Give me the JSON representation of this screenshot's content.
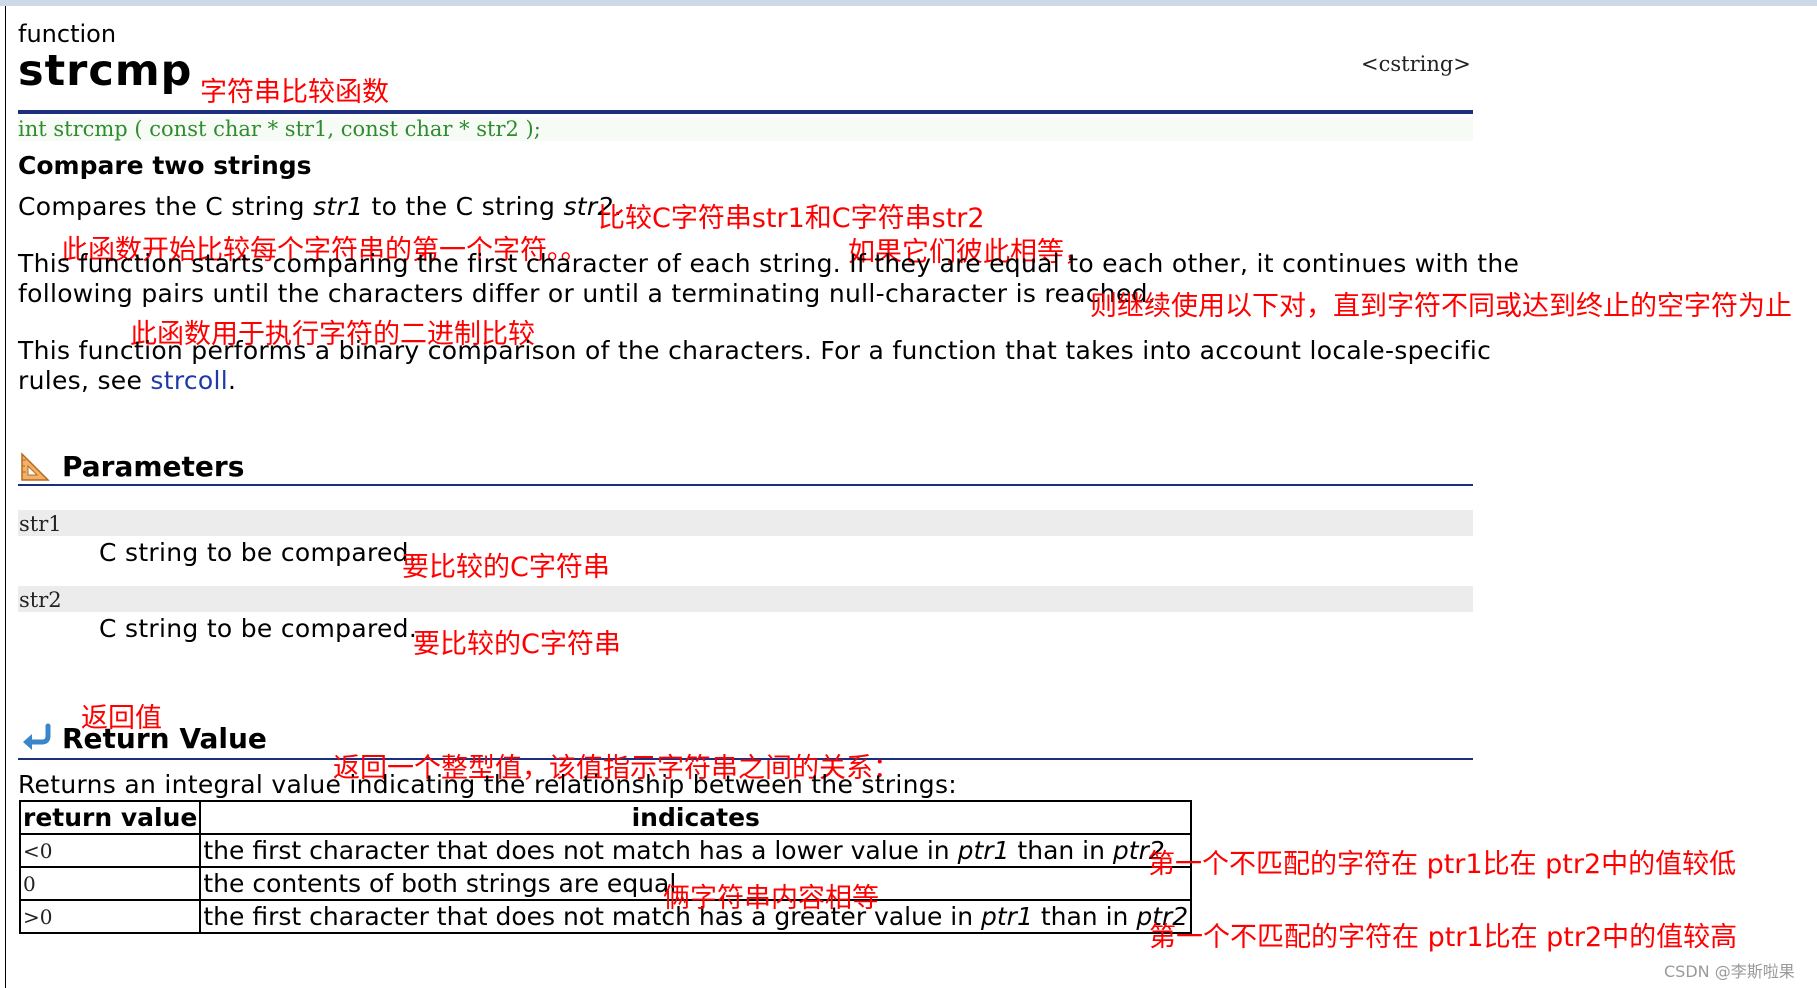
{
  "header": {
    "kind": "function",
    "name": "strcmp",
    "name_cn": "字符串比较函数",
    "library": "<cstring>"
  },
  "prototype": "int strcmp ( const char * str1, const char * str2 );",
  "summary": "Compare two strings",
  "desc1": {
    "p1": "Compares the C string ",
    "v1": "str1",
    "p2": " to the C string ",
    "v2": "str2",
    "p3": ".",
    "cn": "比较C字符串str1和C字符串str2"
  },
  "desc2": {
    "line1": "This function starts comparing the first character of each string. If they are equal to each other, it continues with the",
    "line2": "following pairs until the characters differ or until a terminating null-character is reached.",
    "cn_a": "此函数开始比较每个字符串的第一个字符。。",
    "cn_b": "如果它们彼此相等，",
    "cn_c": "则继续使用以下对，直到字符不同或达到终止的空字符为止"
  },
  "desc3": {
    "line1": "This function performs a binary comparison of the characters. For a function that takes into account locale-specific",
    "line2_pre": "rules, see ",
    "link": "strcoll",
    "line2_post": ".",
    "cn": "此函数用于执行字符的二进制比较"
  },
  "parameters": {
    "title": "Parameters",
    "items": [
      {
        "name": "str1",
        "desc": "C string to be compared.",
        "cn": "要比较的C字符串"
      },
      {
        "name": "str2",
        "desc": "C string to be compared.",
        "cn": "要比较的C字符串"
      }
    ]
  },
  "return_value": {
    "title": "Return Value",
    "title_cn": "返回值",
    "intro": "Returns an integral value indicating the relationship between the strings:",
    "intro_cn": "返回一个整型值，该值指示字符串之间的关系：",
    "headers": [
      "return value",
      "indicates"
    ],
    "rows": [
      {
        "val": "<0",
        "pre": "the first character that does not match has a lower value in ",
        "a": "ptr1",
        "mid": " than in ",
        "b": "ptr2",
        "cn": "第一个不匹配的字符在 ptr1比在 ptr2中的值较低"
      },
      {
        "val": "0",
        "text": "the contents of both strings are equal",
        "cn": "俩字符串内容相等"
      },
      {
        "val": ">0",
        "pre": "the first character that does not match has a greater value in ",
        "a": "ptr1",
        "mid": " than in ",
        "b": "ptr2",
        "cn": "第一个不匹配的字符在 ptr1比在 ptr2中的值较高"
      }
    ]
  },
  "watermark": "CSDN @李斯啦果",
  "colors": {
    "annotation": "#ff0000",
    "rule": "#1c2f7f",
    "prototype": "#2e8b2e",
    "link": "#1f3aa6"
  },
  "icons": {
    "parameters": "ruler-triangle-icon",
    "return": "return-arrow-icon"
  }
}
